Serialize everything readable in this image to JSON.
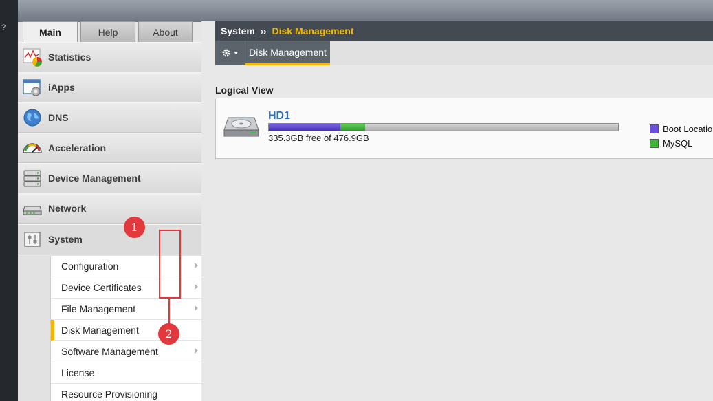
{
  "window": {
    "help_glyph": "?"
  },
  "tabs": [
    {
      "label": "Main",
      "active": true
    },
    {
      "label": "Help",
      "active": false
    },
    {
      "label": "About",
      "active": false
    }
  ],
  "sidebar": {
    "items": [
      {
        "label": "Statistics",
        "icon": "statistics-chart-icon"
      },
      {
        "label": "iApps",
        "icon": "iapps-window-gear-icon"
      },
      {
        "label": "DNS",
        "icon": "dns-globe-icon"
      },
      {
        "label": "Acceleration",
        "icon": "acceleration-gauge-icon"
      },
      {
        "label": "Device Management",
        "icon": "device-management-server-icon"
      },
      {
        "label": "Network",
        "icon": "network-switch-icon"
      },
      {
        "label": "System",
        "icon": "system-sliders-icon"
      }
    ],
    "submenu": [
      {
        "label": "Configuration",
        "has_arrow": true
      },
      {
        "label": "Device Certificates",
        "has_arrow": true
      },
      {
        "label": "File Management",
        "has_arrow": true
      },
      {
        "label": "Disk Management",
        "has_arrow": false,
        "active": true
      },
      {
        "label": "Software Management",
        "has_arrow": true
      },
      {
        "label": "License",
        "has_arrow": false
      },
      {
        "label": "Resource Provisioning",
        "has_arrow": false
      }
    ]
  },
  "breadcrumb": {
    "section": "System",
    "separator": "››",
    "page": "Disk Management"
  },
  "subtab": {
    "label": "Disk Management"
  },
  "logical_view": {
    "title": "Logical View",
    "disk": {
      "name": "HD1",
      "free_text": "335.3GB free of 476.9GB",
      "usage_segments": [
        {
          "name": "Boot Location",
          "fraction": 0.205,
          "color": "#5a45cc"
        },
        {
          "name": "MySQL",
          "fraction": 0.07,
          "color": "#3db338"
        }
      ]
    },
    "legend": [
      {
        "label": "Boot Locatio",
        "color": "#6a4fe0"
      },
      {
        "label": "MySQL",
        "color": "#3db338"
      }
    ]
  },
  "annotations": {
    "marker_1": "1",
    "marker_2": "2"
  },
  "colors": {
    "accent": "#f5b800",
    "annotation": "#e3393c",
    "link": "#2f6fb7"
  }
}
